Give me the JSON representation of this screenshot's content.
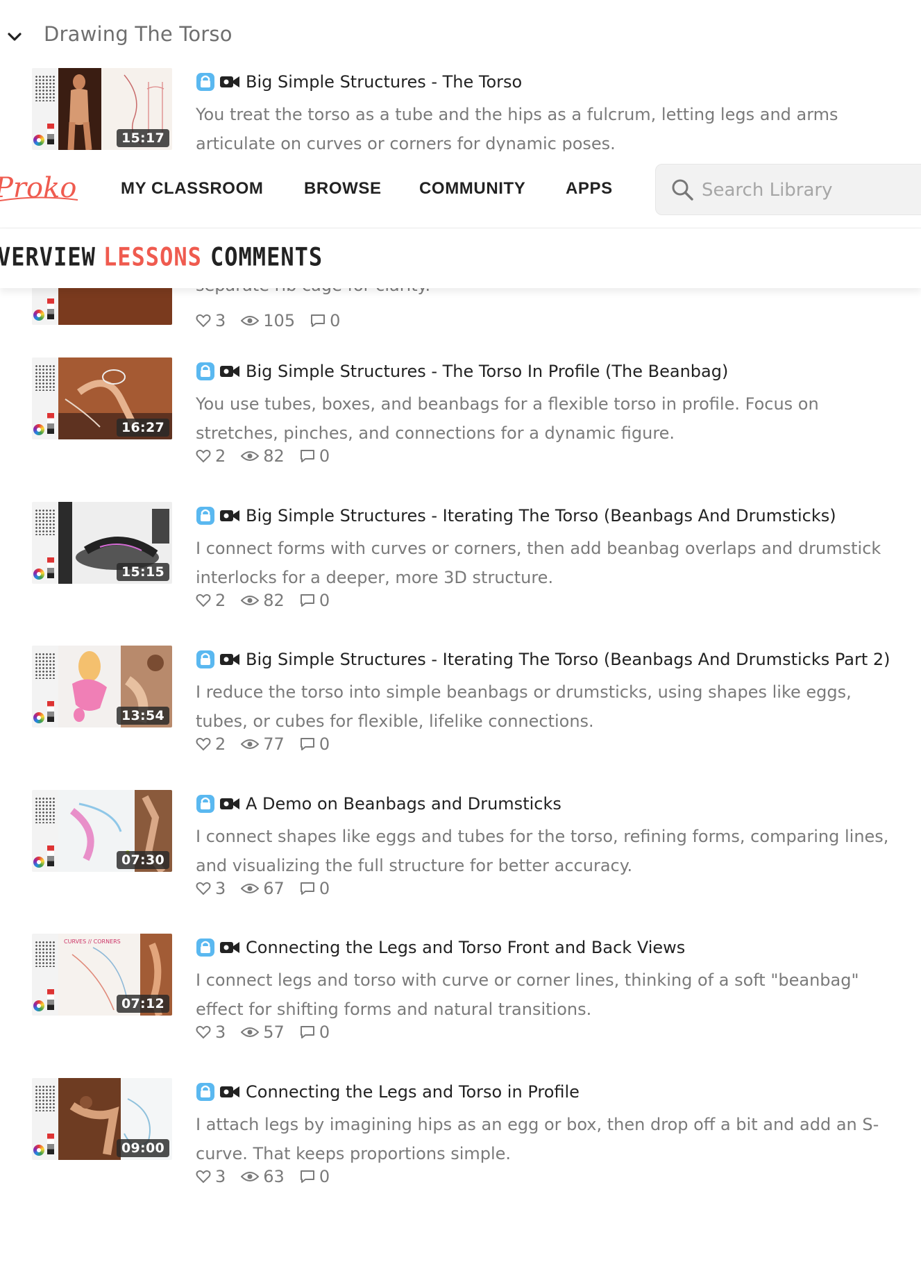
{
  "section": {
    "title": "Drawing The Torso"
  },
  "nav": {
    "logo": "Proko",
    "items": [
      "MY CLASSROOM",
      "BROWSE",
      "COMMUNITY",
      "APPS"
    ],
    "search_placeholder": "Search Library"
  },
  "tabs": {
    "items": [
      "VERVIEW",
      "LESSONS",
      "COMMENTS"
    ],
    "active": "LESSONS"
  },
  "partial_lesson": {
    "desc_tail": "separate rib cage for clarity.",
    "likes": "3",
    "views": "105",
    "comments": "0"
  },
  "lessons": [
    {
      "title": "Big Simple Structures - The Torso",
      "duration": "15:17",
      "desc": "You treat the torso as a tube and the hips as a fulcrum, letting legs and arms articulate on curves or corners for dynamic poses."
    },
    {
      "title": "Big Simple Structures - The Torso In Profile (The Beanbag)",
      "duration": "16:27",
      "desc": "You use tubes, boxes, and beanbags for a flexible torso in profile. Focus on stretches, pinches, and connections for a dynamic figure.",
      "likes": "2",
      "views": "82",
      "comments": "0"
    },
    {
      "title": "Big Simple Structures - Iterating The Torso (Beanbags And Drumsticks)",
      "duration": "15:15",
      "desc": "I connect forms with curves or corners, then add beanbag overlaps and drumstick interlocks for a deeper, more 3D structure.",
      "likes": "2",
      "views": "82",
      "comments": "0"
    },
    {
      "title": "Big Simple Structures - Iterating The Torso (Beanbags And Drumsticks Part 2)",
      "duration": "13:54",
      "desc": "I reduce the torso into simple beanbags or drumsticks, using shapes like eggs, tubes, or cubes for flexible, lifelike connections.",
      "likes": "2",
      "views": "77",
      "comments": "0"
    },
    {
      "title": "A Demo on Beanbags and Drumsticks",
      "duration": "07:30",
      "desc": "I connect shapes like eggs and tubes for the torso, refining forms, comparing lines, and visualizing the full structure for better accuracy.",
      "likes": "3",
      "views": "67",
      "comments": "0"
    },
    {
      "title": "Connecting the Legs and Torso Front and Back Views",
      "duration": "07:12",
      "desc": "I connect legs and torso with curve or corner lines, thinking of a soft \"beanbag\" effect for shifting forms and natural transitions.",
      "likes": "3",
      "views": "57",
      "comments": "0"
    },
    {
      "title": "Connecting the Legs and Torso in Profile",
      "duration": "09:00",
      "desc": "I attach legs by imagining hips as an egg or box, then drop off a bit and add an S-curve. That keeps proportions simple.",
      "likes": "3",
      "views": "63",
      "comments": "0"
    }
  ],
  "colors": {
    "accent": "#ef5b4f",
    "lock": "#5ab8f0",
    "text": "#222222",
    "muted": "#7a7a7a"
  }
}
